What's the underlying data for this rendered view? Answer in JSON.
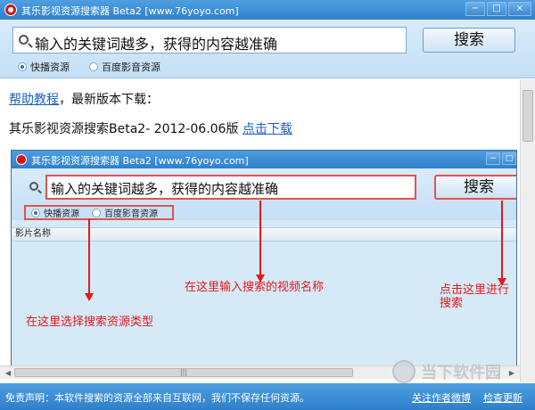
{
  "window": {
    "title": "其乐影视资源搜索器 Beta2 [www.76yoyo.com]",
    "controls": [
      "−",
      "□",
      "×"
    ]
  },
  "search": {
    "placeholder": "输入的关键词越多，获得的内容越准确",
    "button_label": "搜索"
  },
  "sources": [
    {
      "label": "快播资源",
      "selected": true
    },
    {
      "label": "百度影音资源",
      "selected": false
    }
  ],
  "content": {
    "help_link": "帮助教程",
    "help_suffix": "，最新版本下载：",
    "version_text": "其乐影视资源搜索Beta2- 2012-06.06版",
    "download_link": "点击下载"
  },
  "inner_screenshot": {
    "title": "其乐影视资源搜索器 Beta2 [www.76yoyo.com]",
    "search_placeholder": "输入的关键词越多，获得的内容越准确",
    "button_label": "搜索",
    "sources": [
      "快播资源",
      "百度影音资源"
    ],
    "column_header": "影片名称",
    "annotations": {
      "input_hint": "在这里输入搜索的视频名称",
      "source_hint": "在这里选择搜索资源类型",
      "button_hint_line1": "点击这里进行",
      "button_hint_line2": "搜索"
    }
  },
  "scrollbar": {
    "left_arrow": "◀",
    "right_arrow": "▶",
    "grip": "|||"
  },
  "status": {
    "disclaimer": "免责声明：本软件搜索的资源全部来自互联网，我们不保存任何资源。",
    "links": [
      "关注作者微博",
      "检查更新"
    ]
  },
  "watermark": {
    "text": "当下软件园"
  }
}
